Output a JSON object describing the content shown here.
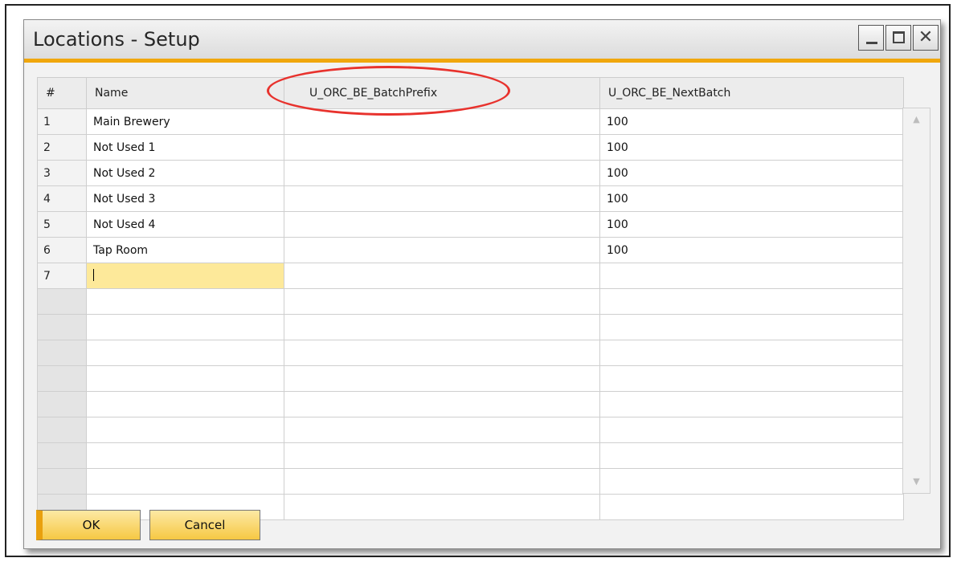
{
  "window": {
    "title": "Locations - Setup"
  },
  "grid": {
    "columns": [
      "#",
      "Name",
      "U_ORC_BE_BatchPrefix",
      "U_ORC_BE_NextBatch"
    ],
    "rows": [
      {
        "num": "1",
        "name": "Main Brewery",
        "prefix": "",
        "next": "100"
      },
      {
        "num": "2",
        "name": "Not Used 1",
        "prefix": "",
        "next": "100"
      },
      {
        "num": "3",
        "name": "Not Used 2",
        "prefix": "",
        "next": "100"
      },
      {
        "num": "4",
        "name": "Not Used 3",
        "prefix": "",
        "next": "100"
      },
      {
        "num": "5",
        "name": "Not Used 4",
        "prefix": "",
        "next": "100"
      },
      {
        "num": "6",
        "name": "Tap Room",
        "prefix": "",
        "next": "100"
      },
      {
        "num": "7",
        "name": "",
        "prefix": "",
        "next": ""
      }
    ],
    "highlighted_column": "U_ORC_BE_BatchPrefix"
  },
  "buttons": {
    "ok": "OK",
    "cancel": "Cancel"
  },
  "colors": {
    "accent": "#f0a70d",
    "highlight_ellipse": "#e8322d",
    "editing_cell": "#fde99a",
    "button_fill": "#f6c843"
  },
  "icons": [
    "minimize-icon",
    "maximize-icon",
    "close-icon",
    "scroll-up-icon",
    "scroll-down-icon"
  ]
}
